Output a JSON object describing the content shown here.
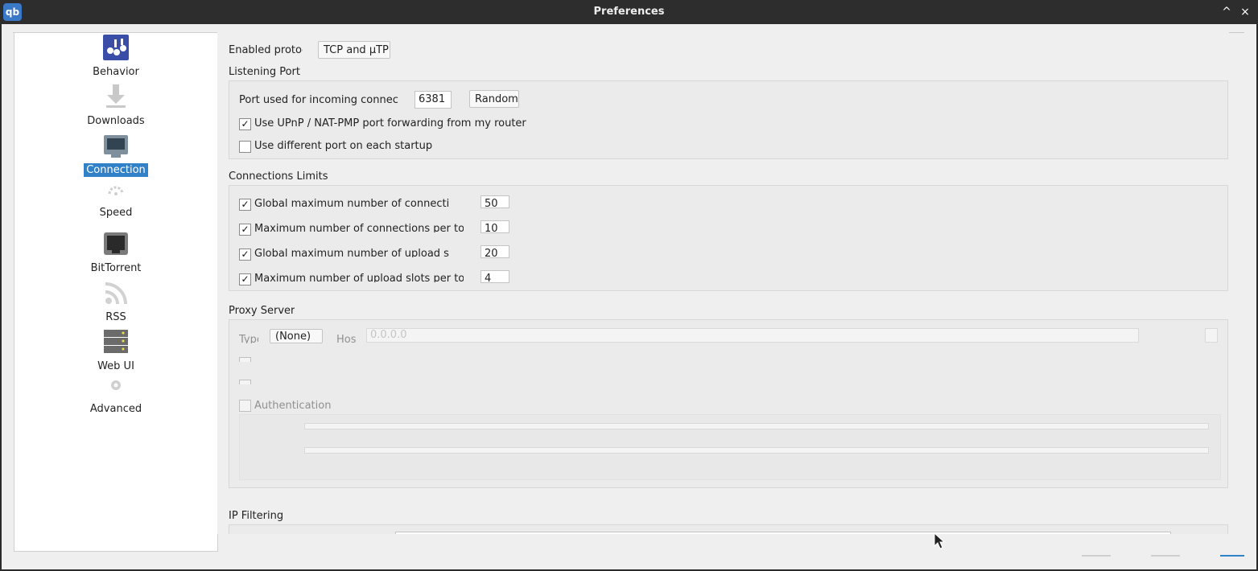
{
  "window": {
    "title": "Preferences",
    "app_icon_text": "qb",
    "controls": {
      "maximize": "^",
      "close": "×"
    }
  },
  "sidebar": {
    "items": [
      {
        "label": "Behavior",
        "icon": "behavior-icon"
      },
      {
        "label": "Downloads",
        "icon": "download-icon"
      },
      {
        "label": "Connection",
        "icon": "network-icon",
        "selected": true
      },
      {
        "label": "Speed",
        "icon": "speedometer-icon"
      },
      {
        "label": "BitTorrent",
        "icon": "bittorrent-icon"
      },
      {
        "label": "RSS",
        "icon": "rss-icon"
      },
      {
        "label": "Web UI",
        "icon": "webui-icon"
      },
      {
        "label": "Advanced",
        "icon": "gear-icon"
      }
    ]
  },
  "connection": {
    "enabled_protocol_label": "Enabled protocol",
    "enabled_protocol_value": "TCP and μTP",
    "listening_port": {
      "title": "Listening Port",
      "port_label": "Port used for incoming connections",
      "port_value": "6381",
      "random_button": "Random",
      "upnp_label": "Use UPnP / NAT-PMP port forwarding from my router",
      "upnp_checked": true,
      "diff_port_label": "Use different port on each startup",
      "diff_port_checked": false
    },
    "limits": {
      "title": "Connections Limits",
      "rows": [
        {
          "label": "Global maximum number of connections:",
          "value": "50",
          "checked": true
        },
        {
          "label": "Maximum number of connections per torrent:",
          "value": "10",
          "checked": true
        },
        {
          "label": "Global maximum number of upload slots:",
          "value": "20",
          "checked": true
        },
        {
          "label": "Maximum number of upload slots per torrent:",
          "value": "4",
          "checked": true
        }
      ]
    },
    "proxy": {
      "title": "Proxy Server",
      "type_label": "Type:",
      "type_value": "(None)",
      "host_label": "Host:",
      "host_placeholder": "0.0.0.0",
      "authentication_label": "Authentication"
    },
    "ip_filtering": {
      "title": "IP Filtering"
    }
  },
  "colors": {
    "selection": "#3081c8",
    "titlebar": "#2d2d2d",
    "background": "#efefef"
  }
}
